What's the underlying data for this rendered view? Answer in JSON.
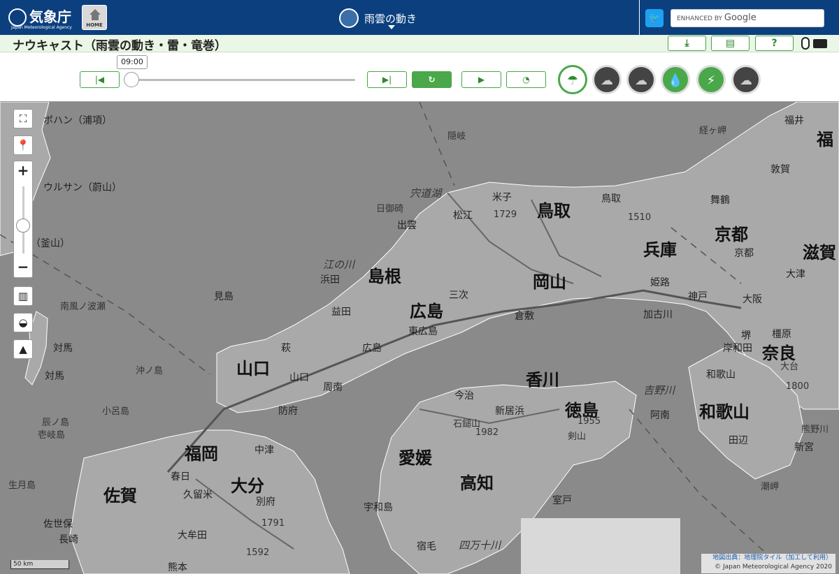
{
  "header": {
    "logo_jp": "気象庁",
    "logo_en": "Japan Meteorological Agency",
    "home_label": "HOME",
    "title": "雨雲の動き",
    "search_prefix": "ENHANCED BY",
    "search_brand": "Google",
    "twitter_icon": "twitter-icon"
  },
  "subheader": {
    "page_title": "ナウキャスト（雨雲の動き・雷・竜巻）",
    "tools": [
      "download-icon",
      "print-icon",
      "help-icon",
      "mouse-icon",
      "keyboard-icon"
    ]
  },
  "controls": {
    "time": "09:00",
    "buttons": [
      "skip-to-start-icon",
      "skip-to-latest-icon",
      "refresh-icon",
      "play-icon",
      "speed-icon"
    ],
    "layers": [
      "rain-cloud-icon",
      "thunder-cloud-icon",
      "tornado-cloud-icon",
      "raindrop-icon",
      "lightning-icon",
      "wind-cloud-icon"
    ]
  },
  "colors": {
    "header_bg": "#0b3f7e",
    "accent_green": "#4aa84a",
    "subheader_bg": "#eaf6e6",
    "map_bg": "#8a8a8a"
  },
  "map": {
    "prefectures": [
      "鳥取",
      "兵庫",
      "京都",
      "滋賀",
      "島根",
      "岡山",
      "広島",
      "山口",
      "奈良",
      "香川",
      "徳島",
      "和歌山",
      "福岡",
      "愛媛",
      "大分",
      "高知",
      "佐賀",
      "福"
    ],
    "cities": [
      "ポハン（浦項）",
      "ウルサン（蔚山）",
      "ン（釜山）",
      "南風ノ波瀬",
      "対馬",
      "対馬",
      "沖ノ島",
      "小呂島",
      "辰ノ島",
      "壱岐島",
      "生月島",
      "隠岐",
      "浜田",
      "出雲",
      "日御碕",
      "松江",
      "米子",
      "益田",
      "萩",
      "山口",
      "周南",
      "防府",
      "三次",
      "東広島",
      "広島",
      "倉敷",
      "姫路",
      "神戸",
      "加古川",
      "大阪",
      "堺",
      "岸和田",
      "和歌山",
      "田辺",
      "新宮",
      "橿原",
      "大台",
      "鳥取",
      "舞鶴",
      "敦賀",
      "福井",
      "京都",
      "大津",
      "今治",
      "新居浜",
      "石鎚山",
      "剣山",
      "中津",
      "別府",
      "宇和島",
      "宿毛",
      "室戸",
      "阿南",
      "吉野川",
      "熊本",
      "大牟田",
      "久留米",
      "春日",
      "佐世保",
      "長崎",
      "見島",
      "江の川",
      "宍道湖",
      "潮岬",
      "熊野川",
      "経ヶ岬"
    ],
    "elevations": [
      "1729",
      "1510",
      "1955",
      "1982",
      "1791",
      "1592",
      "1800"
    ],
    "river_labels": [
      "四万十川"
    ]
  },
  "map_tools": [
    "fullscreen-icon",
    "location-pin-icon",
    "zoom-in-icon",
    "zoom-out-icon",
    "map-layer-icon",
    "water-icon",
    "terrain-icon"
  ],
  "scale_label": "50 km",
  "attribution": {
    "source": "地図出典：地理院タイル（加工して利用）",
    "copyright": "© Japan Meteorological Agency 2020"
  }
}
